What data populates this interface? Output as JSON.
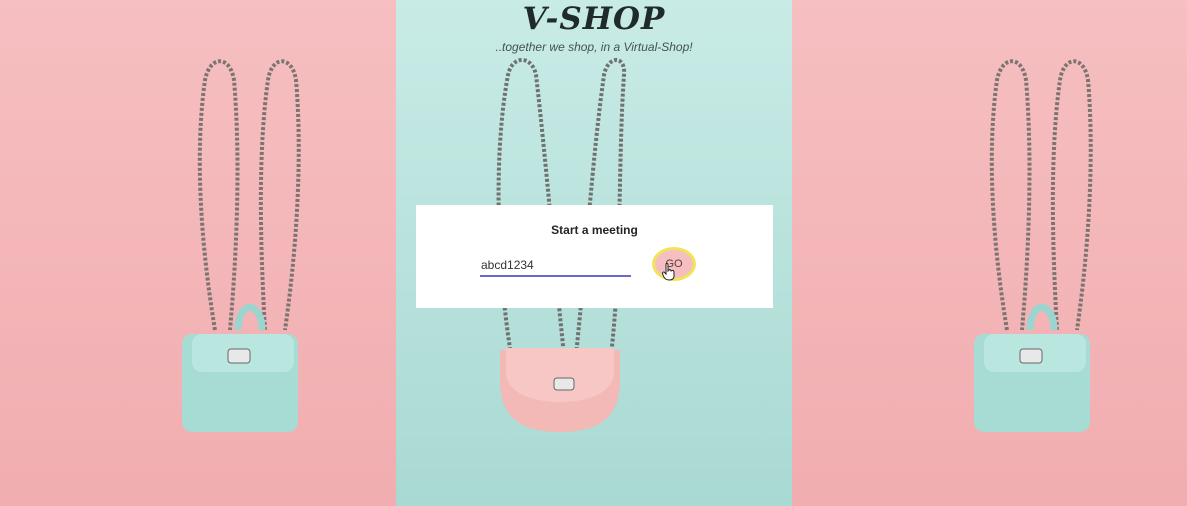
{
  "brand": {
    "title": "V-SHOP",
    "tagline": "..together we shop, in a Virtual-Shop!"
  },
  "dialog": {
    "title": "Start a meeting",
    "meeting_id_value": "abcd1234",
    "go_label": "GO"
  },
  "colors": {
    "pink_background": "#f3b6b8",
    "mint_background": "#bfe4df",
    "input_underline": "#6b68c9",
    "button_highlight": "#f2e45a"
  },
  "images": {
    "left": "mint backpack with chain straps",
    "center": "pink crossbody bag with chain strap",
    "right": "mint backpack with chain straps"
  }
}
